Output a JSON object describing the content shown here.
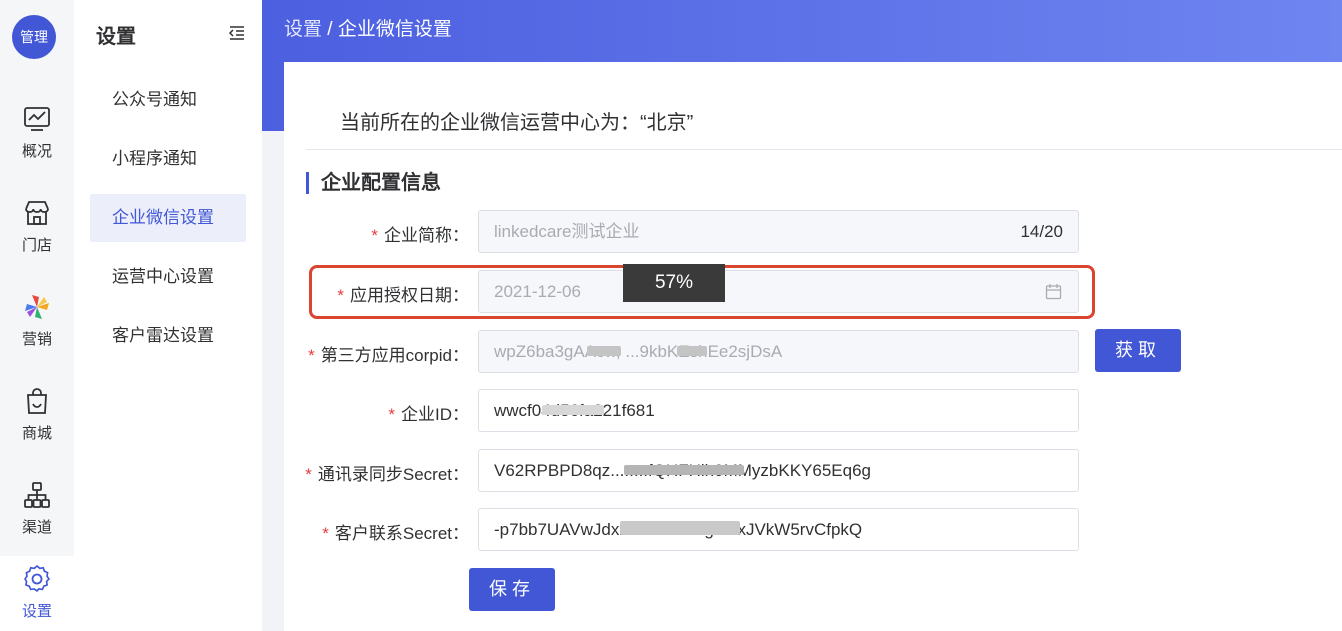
{
  "rail": {
    "logo": "管理",
    "items": [
      {
        "label": "概况",
        "icon": "chart-monitor-icon"
      },
      {
        "label": "门店",
        "icon": "store-icon"
      },
      {
        "label": "营销",
        "icon": "marketing-pinwheel-icon"
      },
      {
        "label": "商城",
        "icon": "shopping-bag-icon"
      },
      {
        "label": "渠道",
        "icon": "hierarchy-icon"
      },
      {
        "label": "设置",
        "icon": "gear-icon"
      }
    ]
  },
  "submenu": {
    "title": "设置",
    "items": [
      {
        "label": "公众号通知"
      },
      {
        "label": "小程序通知"
      },
      {
        "label": "企业微信设置"
      },
      {
        "label": "运营中心设置"
      },
      {
        "label": "客户雷达设置"
      }
    ]
  },
  "breadcrumb": {
    "parent": "设置",
    "separator": " / ",
    "current": "企业微信设置"
  },
  "main": {
    "center_note": "当前所在的企业微信运营中心为：“北京”",
    "section_title": "企业配置信息",
    "zoom_badge": "57%",
    "fields": {
      "company_short_name": {
        "label": "企业简称：",
        "value": "linkedcare测试企业",
        "counter": "14/20"
      },
      "auth_date": {
        "label": "应用授权日期：",
        "value": "2021-12-06"
      },
      "corpid": {
        "label": "第三方应用corpid：",
        "value": "wpZ6ba3gAAcw, ...9kbKEshEe2sjDsA"
      },
      "corp_id": {
        "label": "企业ID：",
        "value": "wwcf04d56fa221f681"
      },
      "contact_secret": {
        "label": "通讯录同步Secret：",
        "value": "V62RPBPD8qz........fQHFHlh0MMyzbKKY65Eq6g"
      },
      "customer_secret": {
        "label": "客户联系Secret：",
        "value": "-p7bb7UAVwJdx2e....BDoa.gttfl-xJVkW5rvCfpkQ"
      }
    },
    "fetch_button": "获取",
    "save_button": "保存"
  },
  "colors": {
    "accent": "#4157d6",
    "required": "#e53e3e",
    "highlight": "#d9452f"
  }
}
